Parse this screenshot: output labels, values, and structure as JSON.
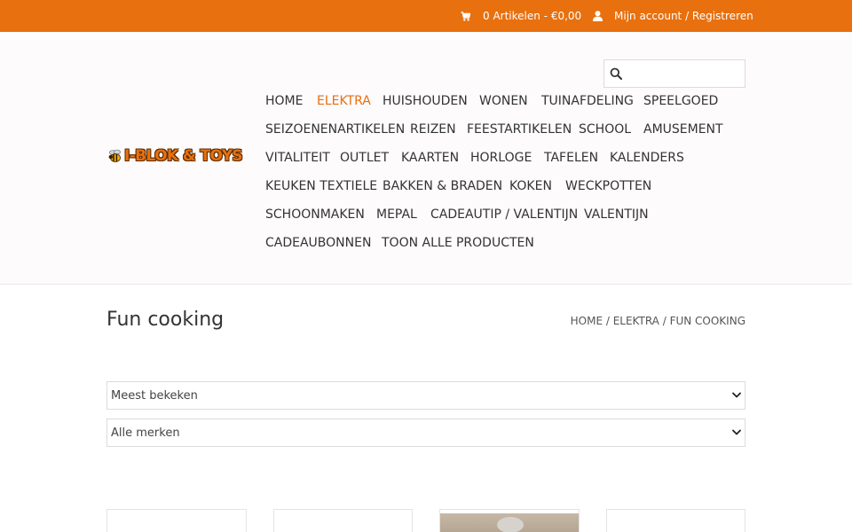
{
  "topbar": {
    "cart_label": "0 Artikelen - €0,00",
    "cart_icon": "cart-icon",
    "account_label": "Mijn account / Registreren",
    "account_icon": "user-icon",
    "bg_color": "#e8700f"
  },
  "logo": {
    "text": "I-BLOK & TOYS",
    "icon": "bee-icon"
  },
  "search": {
    "icon": "search-icon",
    "placeholder": "",
    "value": ""
  },
  "nav": {
    "accent_color": "#e8700f",
    "items": [
      {
        "label": "HOME"
      },
      {
        "label": "ELEKTRA",
        "active": true
      },
      {
        "label": "HUISHOUDEN"
      },
      {
        "label": "WONEN"
      },
      {
        "label": "TUINAFDELING"
      },
      {
        "label": "SPEELGOED"
      },
      {
        "label": "SEIZOENENARTIKELEN"
      },
      {
        "label": "REIZEN"
      },
      {
        "label": "FEESTARTIKELEN"
      },
      {
        "label": "SCHOOL"
      },
      {
        "label": "AMUSEMENT"
      },
      {
        "label": "VITALITEIT"
      },
      {
        "label": "OUTLET"
      },
      {
        "label": "KAARTEN"
      },
      {
        "label": "HORLOGE"
      },
      {
        "label": "TAFELEN"
      },
      {
        "label": "KALENDERS"
      },
      {
        "label": "KEUKEN TEXTIELE"
      },
      {
        "label": "BAKKEN & BRADEN"
      },
      {
        "label": "KOKEN"
      },
      {
        "label": "WECKPOTTEN"
      },
      {
        "label": "SCHOONMAKEN"
      },
      {
        "label": "MEPAL"
      },
      {
        "label": "CADEAUTIP / VALENTIJN"
      },
      {
        "label": "VALENTIJN"
      },
      {
        "label": "CADEAUBONNEN"
      },
      {
        "label": "TOON ALLE PRODUCTEN"
      }
    ]
  },
  "page": {
    "title": "Fun cooking",
    "breadcrumb": [
      "HOME",
      "ELEKTRA",
      "FUN COOKING"
    ],
    "breadcrumb_separator": " / "
  },
  "filters": {
    "sort": {
      "selected": "Meest bekeken",
      "icon": "chevron-down-icon"
    },
    "brand": {
      "selected": "Alle merken",
      "icon": "chevron-down-icon"
    }
  },
  "products": [
    {
      "has_image": false
    },
    {
      "has_image": false
    },
    {
      "has_image": true
    },
    {
      "has_image": false
    }
  ]
}
